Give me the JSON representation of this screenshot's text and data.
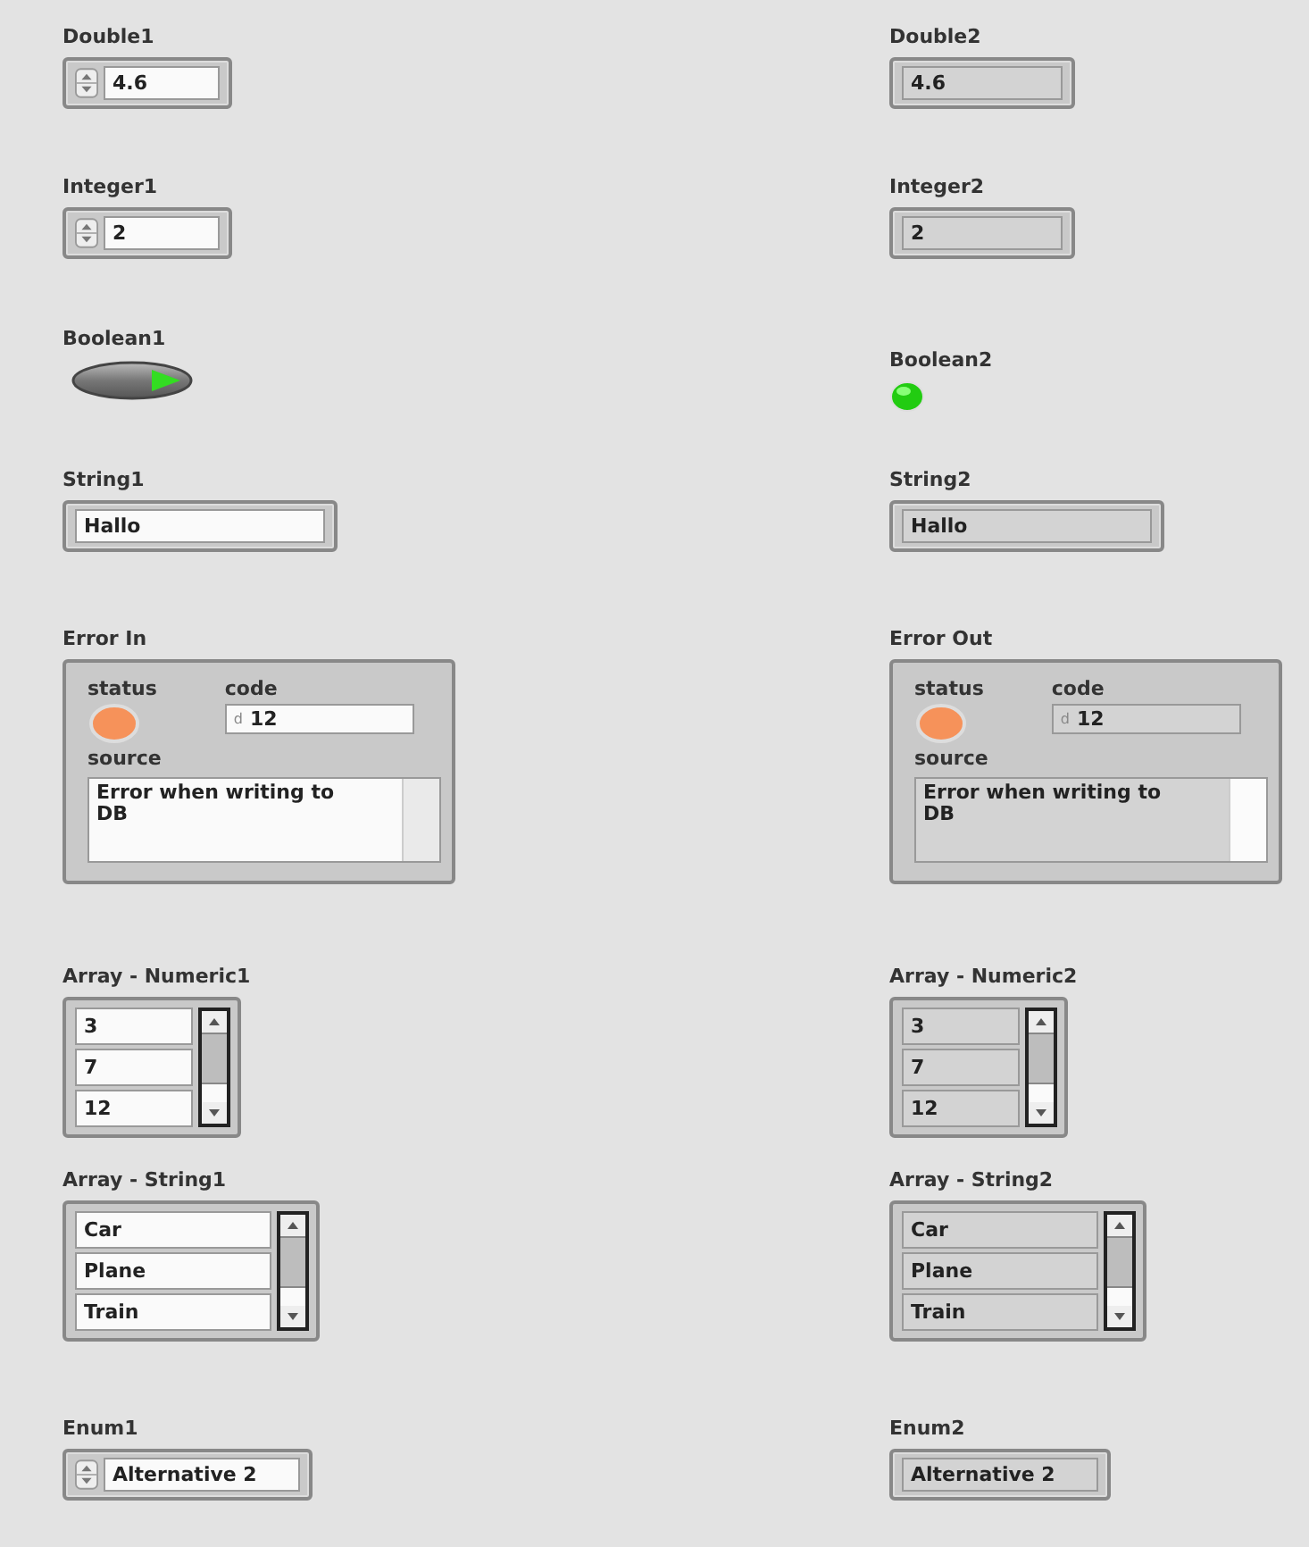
{
  "columns": [
    {
      "kind": "control",
      "items": [
        {
          "kind": "numeric",
          "label": "Double1",
          "value": "4.6"
        },
        {
          "kind": "numeric",
          "label": "Integer1",
          "value": "2"
        },
        {
          "kind": "boolean",
          "label": "Boolean1",
          "on": true
        },
        {
          "kind": "string",
          "label": "String1",
          "value": "Hallo"
        },
        {
          "kind": "error",
          "label": "Error In",
          "status_label": "status",
          "code_label": "code",
          "radix": "d",
          "code": "12",
          "source_label": "source",
          "source": "Error when writing to DB"
        },
        {
          "kind": "array",
          "label": "Array - Numeric1",
          "elements": [
            "3",
            "7",
            "12"
          ]
        },
        {
          "kind": "array_wide",
          "label": "Array - String1",
          "elements": [
            "Car",
            "Plane",
            "Train"
          ]
        },
        {
          "kind": "enum",
          "label": "Enum1",
          "value": "Alternative 2"
        }
      ]
    },
    {
      "kind": "indicator",
      "items": [
        {
          "kind": "numeric",
          "label": "Double2",
          "value": "4.6"
        },
        {
          "kind": "numeric",
          "label": "Integer2",
          "value": "2"
        },
        {
          "kind": "boolean",
          "label": "Boolean2",
          "on": true
        },
        {
          "kind": "string",
          "label": "String2",
          "value": "Hallo"
        },
        {
          "kind": "error",
          "label": "Error Out",
          "status_label": "status",
          "code_label": "code",
          "radix": "d",
          "code": "12",
          "source_label": "source",
          "source": "Error when writing to DB"
        },
        {
          "kind": "array",
          "label": "Array - Numeric2",
          "elements": [
            "3",
            "7",
            "12"
          ]
        },
        {
          "kind": "array_wide",
          "label": "Array - String2",
          "elements": [
            "Car",
            "Plane",
            "Train"
          ]
        },
        {
          "kind": "enum",
          "label": "Enum2",
          "value": "Alternative 2"
        }
      ]
    }
  ]
}
